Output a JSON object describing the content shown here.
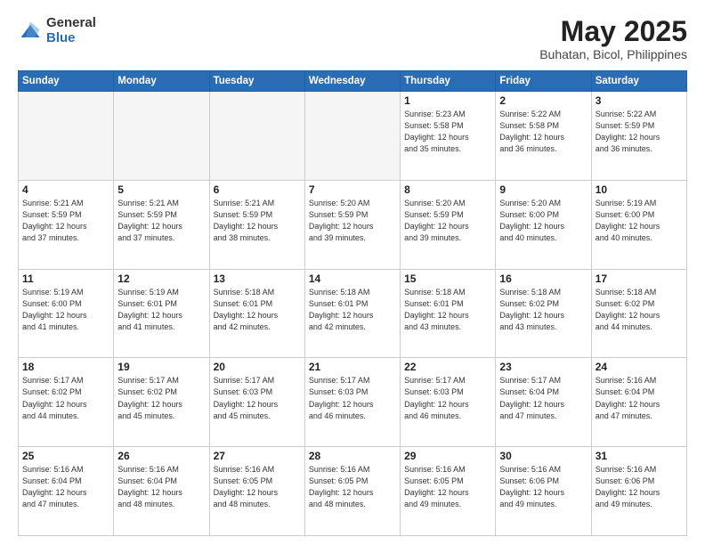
{
  "header": {
    "logo_general": "General",
    "logo_blue": "Blue",
    "title": "May 2025",
    "location": "Buhatan, Bicol, Philippines"
  },
  "days_of_week": [
    "Sunday",
    "Monday",
    "Tuesday",
    "Wednesday",
    "Thursday",
    "Friday",
    "Saturday"
  ],
  "weeks": [
    [
      {
        "day": "",
        "info": ""
      },
      {
        "day": "",
        "info": ""
      },
      {
        "day": "",
        "info": ""
      },
      {
        "day": "",
        "info": ""
      },
      {
        "day": "1",
        "info": "Sunrise: 5:23 AM\nSunset: 5:58 PM\nDaylight: 12 hours\nand 35 minutes."
      },
      {
        "day": "2",
        "info": "Sunrise: 5:22 AM\nSunset: 5:58 PM\nDaylight: 12 hours\nand 36 minutes."
      },
      {
        "day": "3",
        "info": "Sunrise: 5:22 AM\nSunset: 5:59 PM\nDaylight: 12 hours\nand 36 minutes."
      }
    ],
    [
      {
        "day": "4",
        "info": "Sunrise: 5:21 AM\nSunset: 5:59 PM\nDaylight: 12 hours\nand 37 minutes."
      },
      {
        "day": "5",
        "info": "Sunrise: 5:21 AM\nSunset: 5:59 PM\nDaylight: 12 hours\nand 37 minutes."
      },
      {
        "day": "6",
        "info": "Sunrise: 5:21 AM\nSunset: 5:59 PM\nDaylight: 12 hours\nand 38 minutes."
      },
      {
        "day": "7",
        "info": "Sunrise: 5:20 AM\nSunset: 5:59 PM\nDaylight: 12 hours\nand 39 minutes."
      },
      {
        "day": "8",
        "info": "Sunrise: 5:20 AM\nSunset: 5:59 PM\nDaylight: 12 hours\nand 39 minutes."
      },
      {
        "day": "9",
        "info": "Sunrise: 5:20 AM\nSunset: 6:00 PM\nDaylight: 12 hours\nand 40 minutes."
      },
      {
        "day": "10",
        "info": "Sunrise: 5:19 AM\nSunset: 6:00 PM\nDaylight: 12 hours\nand 40 minutes."
      }
    ],
    [
      {
        "day": "11",
        "info": "Sunrise: 5:19 AM\nSunset: 6:00 PM\nDaylight: 12 hours\nand 41 minutes."
      },
      {
        "day": "12",
        "info": "Sunrise: 5:19 AM\nSunset: 6:01 PM\nDaylight: 12 hours\nand 41 minutes."
      },
      {
        "day": "13",
        "info": "Sunrise: 5:18 AM\nSunset: 6:01 PM\nDaylight: 12 hours\nand 42 minutes."
      },
      {
        "day": "14",
        "info": "Sunrise: 5:18 AM\nSunset: 6:01 PM\nDaylight: 12 hours\nand 42 minutes."
      },
      {
        "day": "15",
        "info": "Sunrise: 5:18 AM\nSunset: 6:01 PM\nDaylight: 12 hours\nand 43 minutes."
      },
      {
        "day": "16",
        "info": "Sunrise: 5:18 AM\nSunset: 6:02 PM\nDaylight: 12 hours\nand 43 minutes."
      },
      {
        "day": "17",
        "info": "Sunrise: 5:18 AM\nSunset: 6:02 PM\nDaylight: 12 hours\nand 44 minutes."
      }
    ],
    [
      {
        "day": "18",
        "info": "Sunrise: 5:17 AM\nSunset: 6:02 PM\nDaylight: 12 hours\nand 44 minutes."
      },
      {
        "day": "19",
        "info": "Sunrise: 5:17 AM\nSunset: 6:02 PM\nDaylight: 12 hours\nand 45 minutes."
      },
      {
        "day": "20",
        "info": "Sunrise: 5:17 AM\nSunset: 6:03 PM\nDaylight: 12 hours\nand 45 minutes."
      },
      {
        "day": "21",
        "info": "Sunrise: 5:17 AM\nSunset: 6:03 PM\nDaylight: 12 hours\nand 46 minutes."
      },
      {
        "day": "22",
        "info": "Sunrise: 5:17 AM\nSunset: 6:03 PM\nDaylight: 12 hours\nand 46 minutes."
      },
      {
        "day": "23",
        "info": "Sunrise: 5:17 AM\nSunset: 6:04 PM\nDaylight: 12 hours\nand 47 minutes."
      },
      {
        "day": "24",
        "info": "Sunrise: 5:16 AM\nSunset: 6:04 PM\nDaylight: 12 hours\nand 47 minutes."
      }
    ],
    [
      {
        "day": "25",
        "info": "Sunrise: 5:16 AM\nSunset: 6:04 PM\nDaylight: 12 hours\nand 47 minutes."
      },
      {
        "day": "26",
        "info": "Sunrise: 5:16 AM\nSunset: 6:04 PM\nDaylight: 12 hours\nand 48 minutes."
      },
      {
        "day": "27",
        "info": "Sunrise: 5:16 AM\nSunset: 6:05 PM\nDaylight: 12 hours\nand 48 minutes."
      },
      {
        "day": "28",
        "info": "Sunrise: 5:16 AM\nSunset: 6:05 PM\nDaylight: 12 hours\nand 48 minutes."
      },
      {
        "day": "29",
        "info": "Sunrise: 5:16 AM\nSunset: 6:05 PM\nDaylight: 12 hours\nand 49 minutes."
      },
      {
        "day": "30",
        "info": "Sunrise: 5:16 AM\nSunset: 6:06 PM\nDaylight: 12 hours\nand 49 minutes."
      },
      {
        "day": "31",
        "info": "Sunrise: 5:16 AM\nSunset: 6:06 PM\nDaylight: 12 hours\nand 49 minutes."
      }
    ]
  ]
}
